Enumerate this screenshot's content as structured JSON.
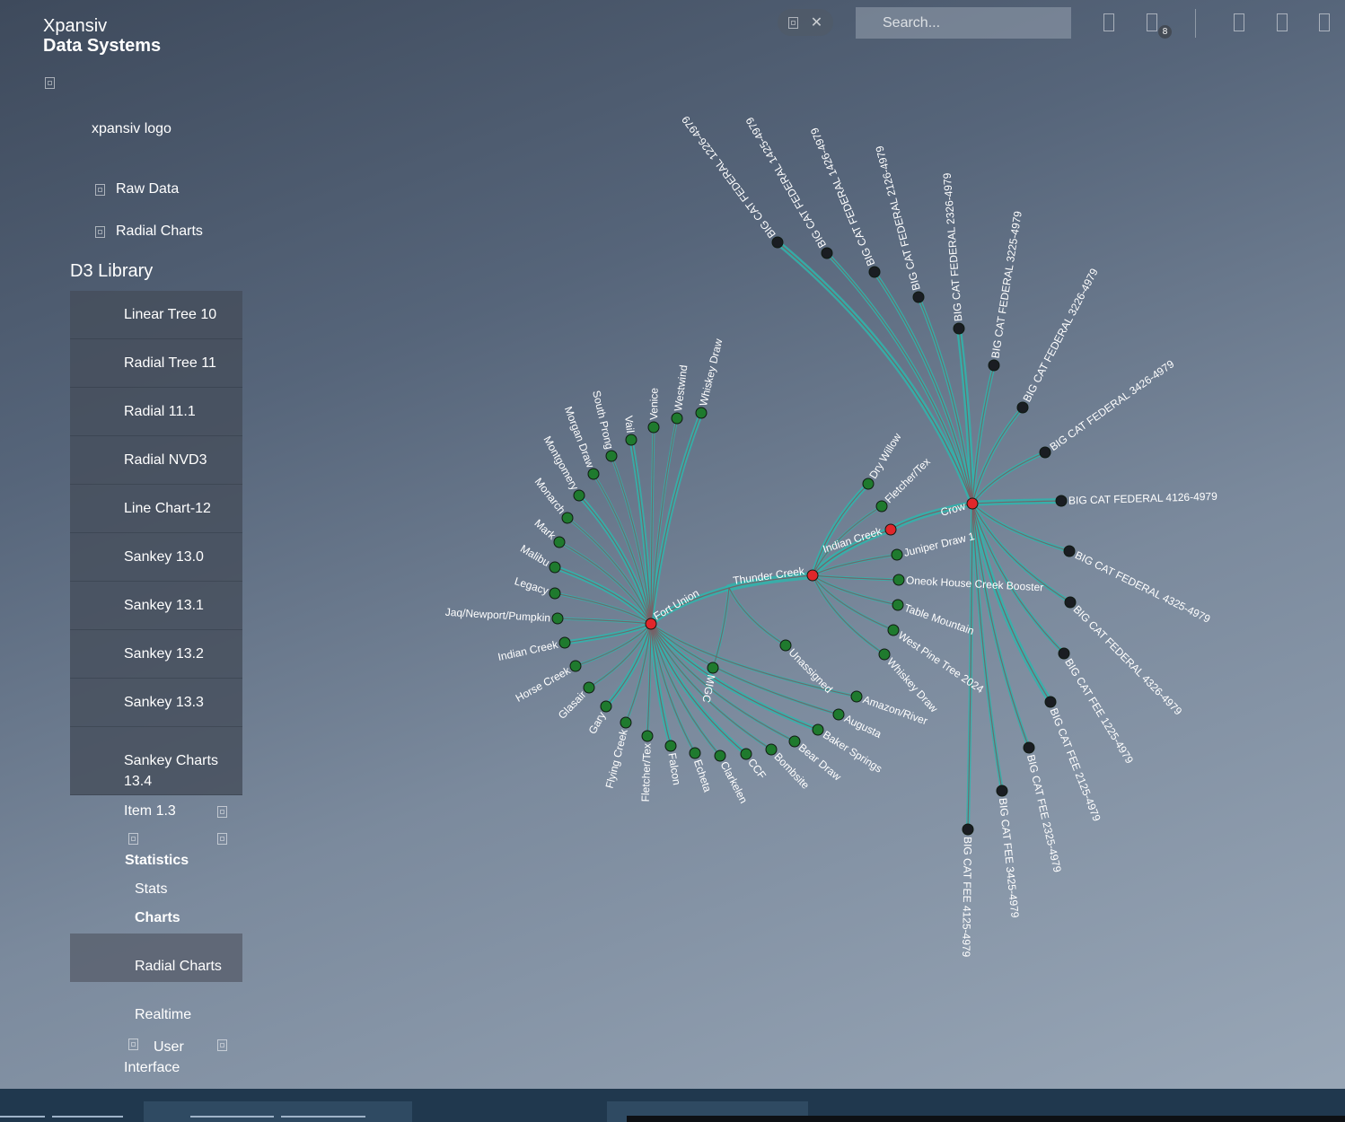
{
  "brand": {
    "line1": "Xpansiv",
    "line2": "Data Systems"
  },
  "logo_alt": "xpansiv logo",
  "nav": {
    "raw_data": "Raw Data",
    "radial_charts": "Radial Charts"
  },
  "section_title": "D3 Library",
  "menu": [
    "Linear Tree 10",
    "Radial Tree 11",
    "Radial 11.1",
    "Radial NVD3",
    "Line Chart-12",
    "Sankey 13.0",
    "Sankey 13.1",
    "Sankey 13.2",
    "Sankey 13.3",
    "Sankey Charts 13.4"
  ],
  "submenu": {
    "item13": "Item 1.3",
    "statistics": "Statistics",
    "stats": "Stats",
    "charts": "Charts",
    "radial_charts": "Radial Charts",
    "realtime": "Realtime",
    "user_interface": "User Interface"
  },
  "search": {
    "placeholder": "Search..."
  },
  "notifications": {
    "badge": "8"
  },
  "colors": {
    "link": "#2fb5ad",
    "link_edge": "#7b5d64",
    "root_node": "#e0272b",
    "leaf_green": "#1f7a2e",
    "leaf_dark": "#1a1d22"
  },
  "chart_data": {
    "type": "radial-tree",
    "root": "Thunder Creek",
    "hubs": {
      "fort_union": {
        "name": "Fort Union",
        "children": [
          "Whiskey Draw",
          "Westwind",
          "Venice",
          "Vail",
          "South Prong",
          "Morgan Draw",
          "Montgomery",
          "Monarch",
          "Mark",
          "Malibu",
          "Legacy",
          "Jaq/Newport/Pumpkin",
          "Indian Creek",
          "Horse Creek",
          "Glasair",
          "Gary",
          "Flying Creek",
          "Fletcher/Tex",
          "Falcon",
          "Echeta",
          "Clarkelen",
          "CCF",
          "Bombsite",
          "Bear Draw",
          "Baker Springs",
          "Augusta",
          "Amazon/River"
        ]
      },
      "thunder_creek": {
        "name": "Thunder Creek",
        "direct_children": [
          "MIGC",
          "Unassigned",
          "Dry Willow",
          "Fletcher/Tex",
          "Juniper Draw 1",
          "Oneok House Creek Booster",
          "Table Mountain",
          "West Pine Tree 2024",
          "Whiskey Draw"
        ]
      },
      "indian_creek": {
        "name": "Indian Creek"
      },
      "crow": {
        "name": "Crow",
        "children": [
          "BIG CAT FEDERAL 1226-4979",
          "BIG CAT FEDERAL 1425-4979",
          "BIG CAT FEDERAL 1426-4979",
          "BIG CAT FEDERAL 2126-4979",
          "BIG CAT FEDERAL 2326-4979",
          "BIG CAT FEDERAL 3225-4979",
          "BIG CAT FEDERAL 3226-4979",
          "BIG CAT FEDERAL 3426-4979",
          "BIG CAT FEDERAL 4126-4979",
          "BIG CAT FEDERAL 4325-4979",
          "BIG CAT FEDERAL 4326-4979",
          "BIG CAT FEE 1225-4979",
          "BIG CAT FEE 2125-4979",
          "BIG CAT FEE 2325-4979",
          "BIG CAT FEE 3425-4979",
          "BIG CAT FEE 4125-4979"
        ]
      }
    }
  }
}
